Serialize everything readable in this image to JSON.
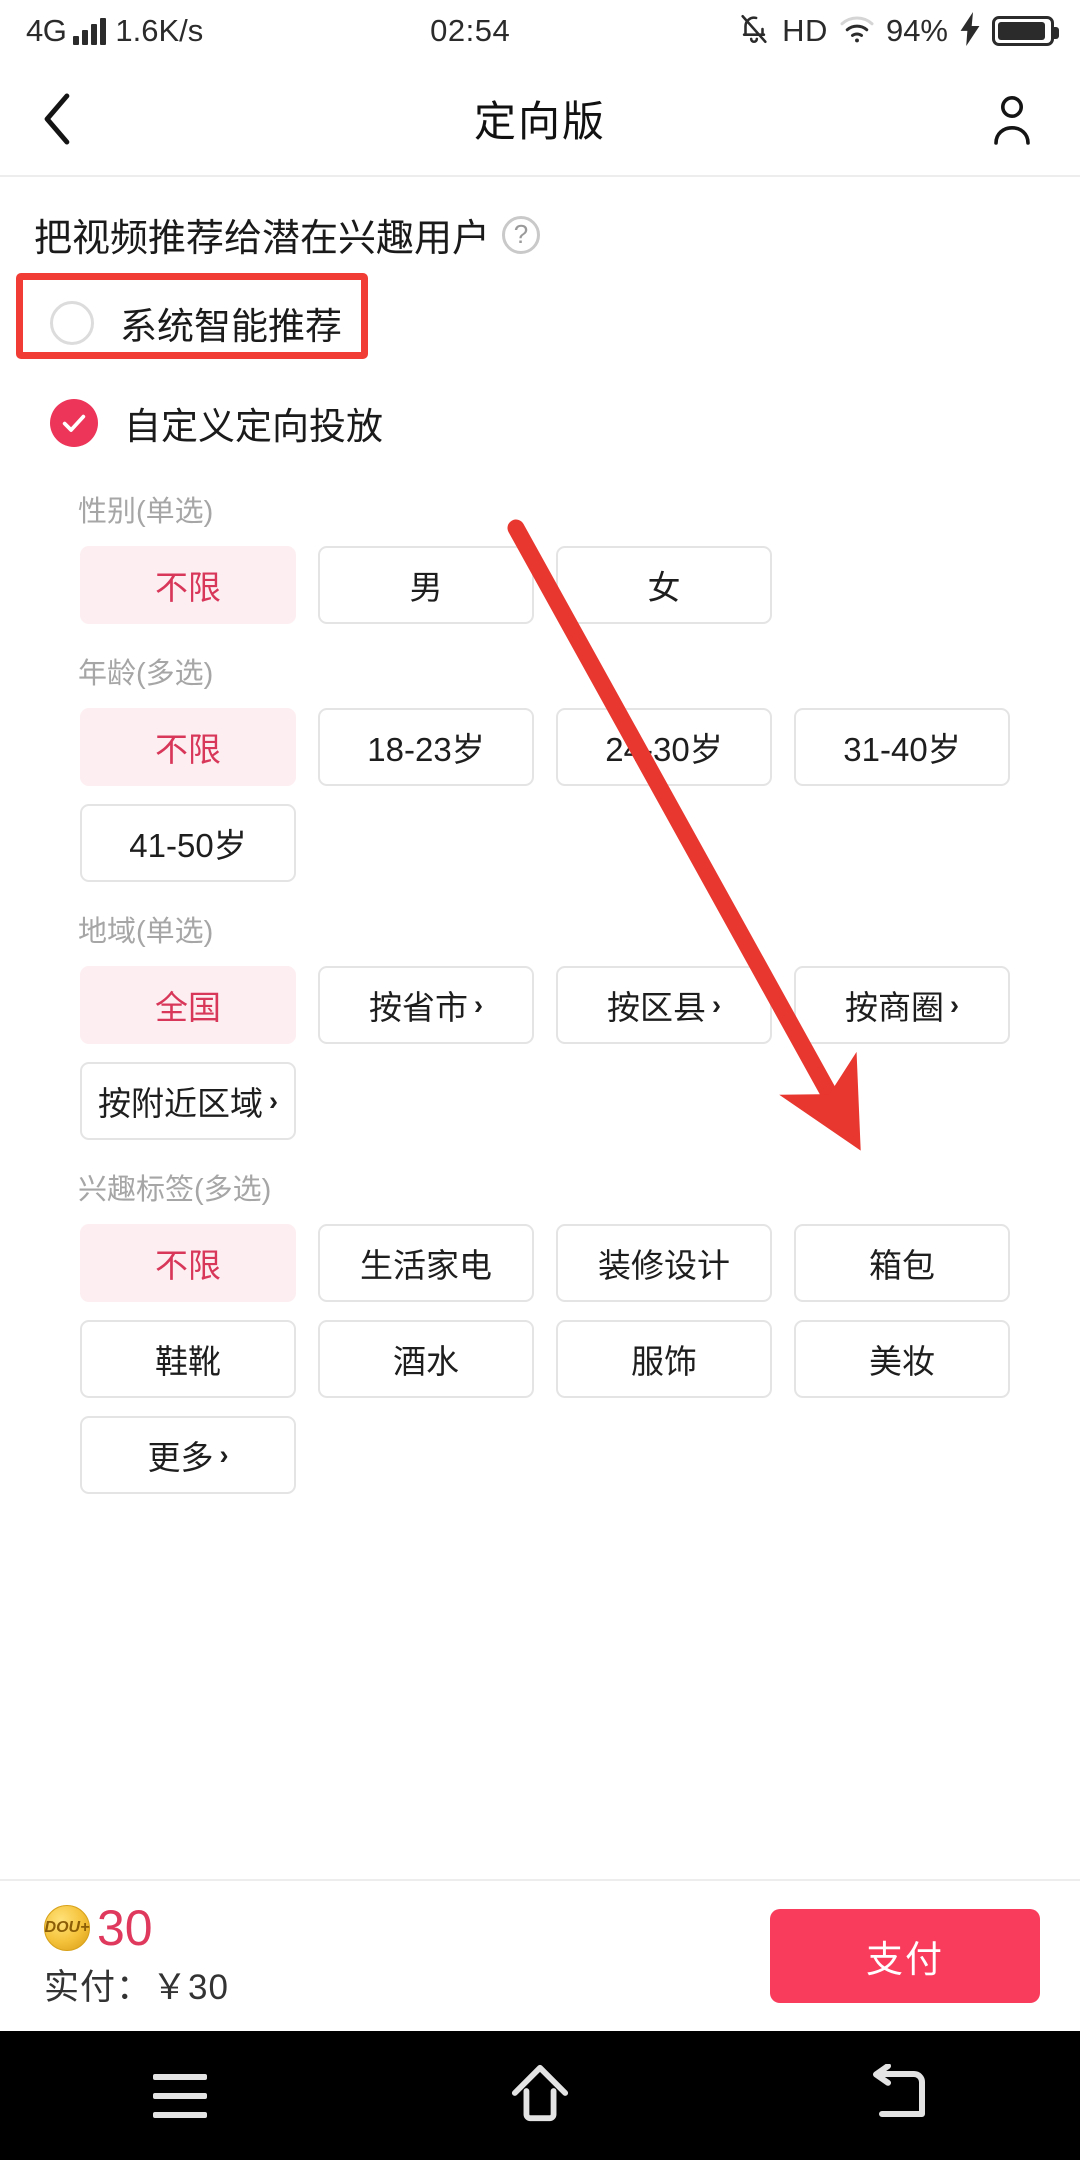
{
  "statusbar": {
    "network": "4G",
    "speed": "1.6K/s",
    "time": "02:54",
    "hd": "HD",
    "battery_pct": "94%",
    "icons": [
      "signal-bars-icon",
      "bell-off-icon",
      "wifi-icon",
      "charging-bolt-icon",
      "battery-icon"
    ]
  },
  "header": {
    "title": "定向版",
    "back_icon": "chevron-left-icon",
    "account_icon": "person-icon"
  },
  "main": {
    "subtitle": "把视频推荐给潜在兴趣用户",
    "help_icon": "question-mark-icon",
    "modes": [
      {
        "label": "系统智能推荐",
        "selected": false
      },
      {
        "label": "自定义定向投放",
        "selected": true
      }
    ],
    "groups": [
      {
        "title": "性别(单选)",
        "options": [
          {
            "label": "不限",
            "selected": true,
            "chevron": false
          },
          {
            "label": "男",
            "selected": false,
            "chevron": false
          },
          {
            "label": "女",
            "selected": false,
            "chevron": false
          }
        ]
      },
      {
        "title": "年龄(多选)",
        "options": [
          {
            "label": "不限",
            "selected": true,
            "chevron": false
          },
          {
            "label": "18-23岁",
            "selected": false,
            "chevron": false
          },
          {
            "label": "24-30岁",
            "selected": false,
            "chevron": false
          },
          {
            "label": "31-40岁",
            "selected": false,
            "chevron": false
          },
          {
            "label": "41-50岁",
            "selected": false,
            "chevron": false
          }
        ]
      },
      {
        "title": "地域(单选)",
        "options": [
          {
            "label": "全国",
            "selected": true,
            "chevron": false
          },
          {
            "label": "按省市",
            "selected": false,
            "chevron": true
          },
          {
            "label": "按区县",
            "selected": false,
            "chevron": true
          },
          {
            "label": "按商圈",
            "selected": false,
            "chevron": true
          },
          {
            "label": "按附近区域",
            "selected": false,
            "chevron": true
          }
        ]
      },
      {
        "title": "兴趣标签(多选)",
        "options": [
          {
            "label": "不限",
            "selected": true,
            "chevron": false
          },
          {
            "label": "生活家电",
            "selected": false,
            "chevron": false
          },
          {
            "label": "装修设计",
            "selected": false,
            "chevron": false
          },
          {
            "label": "箱包",
            "selected": false,
            "chevron": false
          },
          {
            "label": "鞋靴",
            "selected": false,
            "chevron": false
          },
          {
            "label": "酒水",
            "selected": false,
            "chevron": false
          },
          {
            "label": "服饰",
            "selected": false,
            "chevron": false
          },
          {
            "label": "美妆",
            "selected": false,
            "chevron": false
          },
          {
            "label": "更多",
            "selected": false,
            "chevron": true
          }
        ]
      }
    ]
  },
  "bottombar": {
    "coin_label": "DOU+",
    "coin_icon": "dou-plus-coin-icon",
    "amount": "30",
    "paid_text": "实付：￥30",
    "pay_label": "支付"
  },
  "androidnav": {
    "recents_icon": "menu-icon",
    "home_icon": "home-arrow-icon",
    "back_icon": "back-return-icon"
  },
  "annotations": {
    "highlight_color": "#f03c35",
    "arrow_color": "#e8372f",
    "highlight_target": "自定义定向投放",
    "arrow_target": "按区县"
  },
  "colors": {
    "accent": "#f93b5c",
    "selected_chip_bg": "#fdeef1",
    "selected_chip_text": "#d8375a",
    "price_text": "#e0395e"
  }
}
